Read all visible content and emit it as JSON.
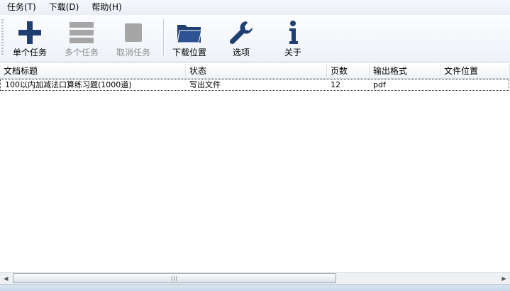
{
  "menu": {
    "items": [
      "任务(T)",
      "下载(D)",
      "帮助(H)"
    ]
  },
  "toolbar": {
    "buttons": [
      {
        "label": "单个任务",
        "icon": "plus-icon",
        "enabled": true
      },
      {
        "label": "多个任务",
        "icon": "list-icon",
        "enabled": false
      },
      {
        "label": "取消任务",
        "icon": "stop-icon",
        "enabled": false
      },
      {
        "label": "下载位置",
        "icon": "folder-icon",
        "enabled": true
      },
      {
        "label": "选项",
        "icon": "wrench-icon",
        "enabled": true
      },
      {
        "label": "关于",
        "icon": "info-icon",
        "enabled": true
      }
    ]
  },
  "table": {
    "columns": [
      "文档标题",
      "状态",
      "页数",
      "输出格式",
      "文件位置"
    ],
    "rows": [
      {
        "title": "100以内加减法口算练习题(1000道)",
        "status": "写出文件",
        "pages": "12",
        "format": "pdf",
        "location": ""
      }
    ]
  },
  "scrollbar": {
    "grip": "|||"
  },
  "colors": {
    "icon_blue": "#1f3f73",
    "icon_disabled": "#a6a6a6"
  }
}
